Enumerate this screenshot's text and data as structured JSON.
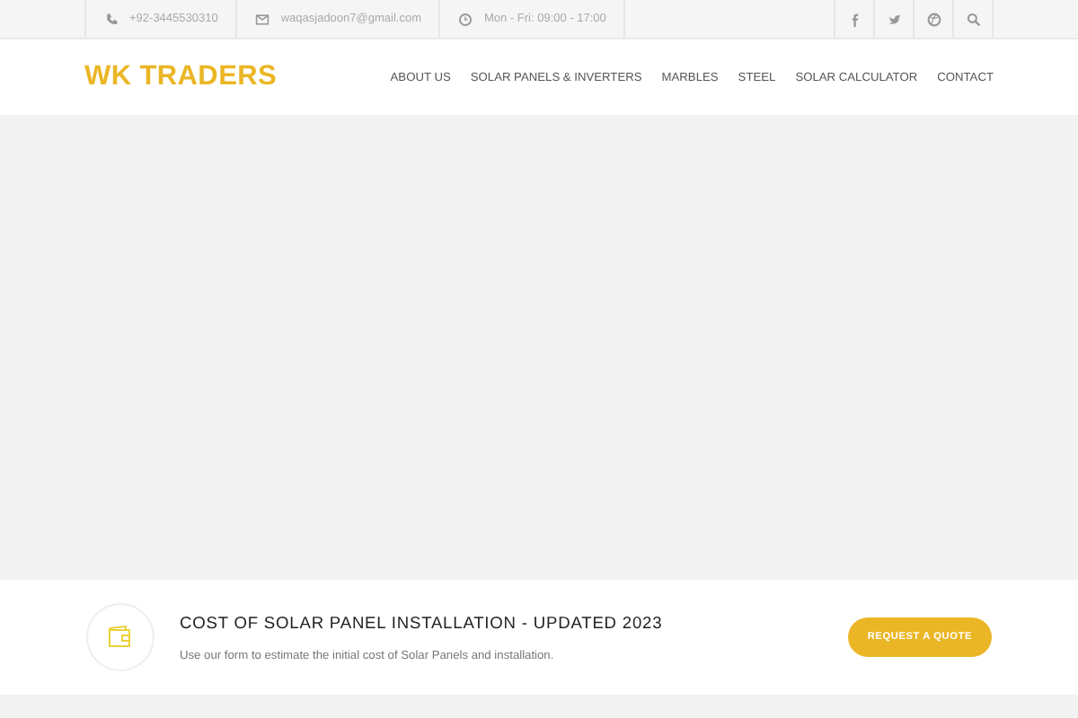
{
  "topbar": {
    "contacts": [
      {
        "kind": "phone",
        "text": "+92-3445530310"
      },
      {
        "kind": "mail",
        "text": "waqasjadoon7@gmail.com"
      },
      {
        "kind": "clock",
        "text": "Mon - Fri: 09:00 - 17:00"
      }
    ]
  },
  "header": {
    "logo": "WK TRADERS",
    "nav": [
      "ABOUT US",
      "SOLAR PANELS & INVERTERS",
      "MARBLES",
      "STEEL",
      "SOLAR CALCULATOR",
      "CONTACT"
    ]
  },
  "promo": {
    "title": "COST OF SOLAR PANEL INSTALLATION - UPDATED 2023",
    "text": "Use our form to estimate the initial cost of Solar Panels and installation.",
    "button": "REQUEST A QUOTE"
  }
}
